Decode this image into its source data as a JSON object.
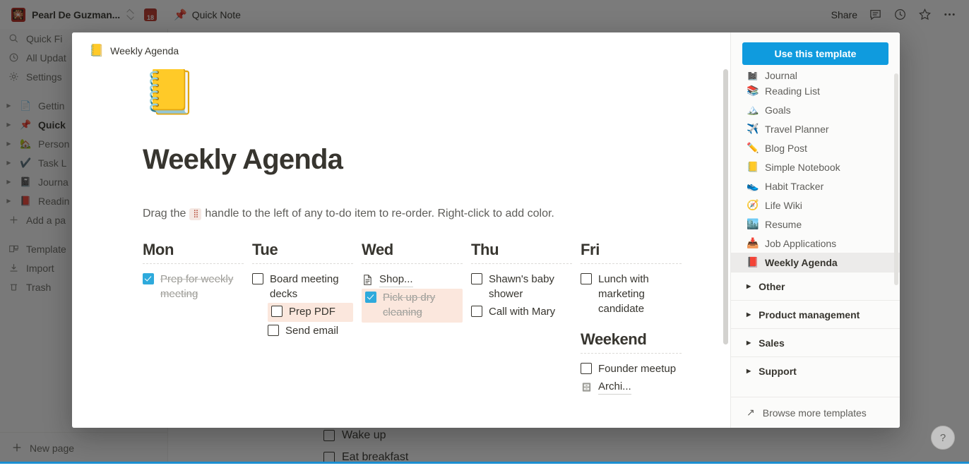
{
  "topbar": {
    "workspace_name": "Pearl De Guzman...",
    "workspace_avatar_emoji": "🎇",
    "calendar_badge": "18",
    "page_emoji": "📌",
    "page_title": "Quick Note",
    "share_label": "Share",
    "icons": [
      "comment-icon",
      "clock-icon",
      "star-icon",
      "more-icon"
    ]
  },
  "sidebar": {
    "quick_items": [
      {
        "label": "Quick Fi",
        "icon": "search-icon"
      },
      {
        "label": "All Updat",
        "icon": "clock-icon"
      },
      {
        "label": "Settings",
        "icon": "gear-icon"
      }
    ],
    "pages": [
      {
        "label": "Gettin",
        "emoji": "📄",
        "bold": false
      },
      {
        "label": "Quick",
        "emoji": "📌",
        "bold": true
      },
      {
        "label": "Person",
        "emoji": "🏡",
        "bold": false
      },
      {
        "label": "Task L",
        "emoji": "✔️",
        "bold": false
      },
      {
        "label": "Journa",
        "emoji": "📓",
        "bold": false
      },
      {
        "label": "Readin",
        "emoji": "📕",
        "bold": false
      }
    ],
    "add_page": "Add a pa",
    "tools": [
      {
        "label": "Template",
        "icon": "templates-icon"
      },
      {
        "label": "Import",
        "icon": "import-icon"
      },
      {
        "label": "Trash",
        "icon": "trash-icon"
      }
    ],
    "new_page": "New page"
  },
  "background_doc": {
    "todos": [
      "Wake up",
      "Eat breakfast"
    ]
  },
  "modal": {
    "header": {
      "emoji": "📒",
      "title": "Weekly Agenda"
    },
    "preview": {
      "page_emoji": "📒",
      "page_title": "Weekly Agenda",
      "description_before": "Drag the",
      "description_after": "handle to the left of any to-do item to re-order. Right-click to add color.",
      "handle_icon": "drag-handle-icon",
      "columns": [
        {
          "day": "Mon",
          "items": [
            {
              "type": "todo",
              "text": "Prep for weekly meeting",
              "checked": true,
              "highlight": false,
              "indent": false
            }
          ],
          "sections": []
        },
        {
          "day": "Tue",
          "items": [
            {
              "type": "todo",
              "text": "Board meeting decks",
              "checked": false,
              "highlight": false,
              "indent": false
            },
            {
              "type": "todo",
              "text": "Prep PDF",
              "checked": false,
              "highlight": true,
              "indent": true
            },
            {
              "type": "todo",
              "text": "Send email",
              "checked": false,
              "highlight": false,
              "indent": true
            }
          ],
          "sections": []
        },
        {
          "day": "Wed",
          "items": [
            {
              "type": "pagelink",
              "text": "Shop...",
              "icon": "page-icon"
            },
            {
              "type": "todo",
              "text": "Pick up dry cleaning",
              "checked": true,
              "highlight": true,
              "indent": false
            }
          ],
          "sections": []
        },
        {
          "day": "Thu",
          "items": [
            {
              "type": "todo",
              "text": "Shawn's baby shower",
              "checked": false,
              "highlight": false,
              "indent": false
            },
            {
              "type": "todo",
              "text": "Call with Mary",
              "checked": false,
              "highlight": false,
              "indent": false
            }
          ],
          "sections": []
        },
        {
          "day": "Fri",
          "items": [
            {
              "type": "todo",
              "text": "Lunch with marketing candidate",
              "checked": false,
              "highlight": false,
              "indent": false
            }
          ],
          "sections": [
            {
              "title": "Weekend",
              "items": [
                {
                  "type": "todo",
                  "text": "Founder meetup",
                  "checked": false,
                  "highlight": false,
                  "indent": false
                },
                {
                  "type": "pagelink",
                  "text": "Archi...",
                  "icon": "file-cabinet-icon"
                }
              ]
            }
          ]
        }
      ]
    },
    "side": {
      "use_template_label": "Use this template",
      "templates": [
        {
          "label": "Journal",
          "emoji": "📓",
          "active": false,
          "clipped": true
        },
        {
          "label": "Reading List",
          "emoji": "📚",
          "active": false,
          "clipped": false
        },
        {
          "label": "Goals",
          "emoji": "🏔️",
          "active": false,
          "clipped": false
        },
        {
          "label": "Travel Planner",
          "emoji": "✈️",
          "active": false,
          "clipped": false
        },
        {
          "label": "Blog Post",
          "emoji": "✏️",
          "active": false,
          "clipped": false
        },
        {
          "label": "Simple Notebook",
          "emoji": "📒",
          "active": false,
          "clipped": false
        },
        {
          "label": "Habit Tracker",
          "emoji": "👟",
          "active": false,
          "clipped": false
        },
        {
          "label": "Life Wiki",
          "emoji": "🧭",
          "active": false,
          "clipped": false
        },
        {
          "label": "Resume",
          "emoji": "🏙️",
          "active": false,
          "clipped": false
        },
        {
          "label": "Job Applications",
          "emoji": "📥",
          "active": false,
          "clipped": false
        },
        {
          "label": "Weekly Agenda",
          "emoji": "📕",
          "active": true,
          "clipped": false
        }
      ],
      "groups": [
        "Other",
        "Product management",
        "Sales",
        "Support"
      ],
      "browse_more": "Browse more templates"
    }
  },
  "help_button": "?",
  "colors": {
    "accent_blue": "#0f9bde",
    "checkbox_blue": "#2eaadc",
    "highlight_peach": "#fbe7dd",
    "text_primary": "#37352f",
    "bottom_line": "#1b8fd1"
  }
}
